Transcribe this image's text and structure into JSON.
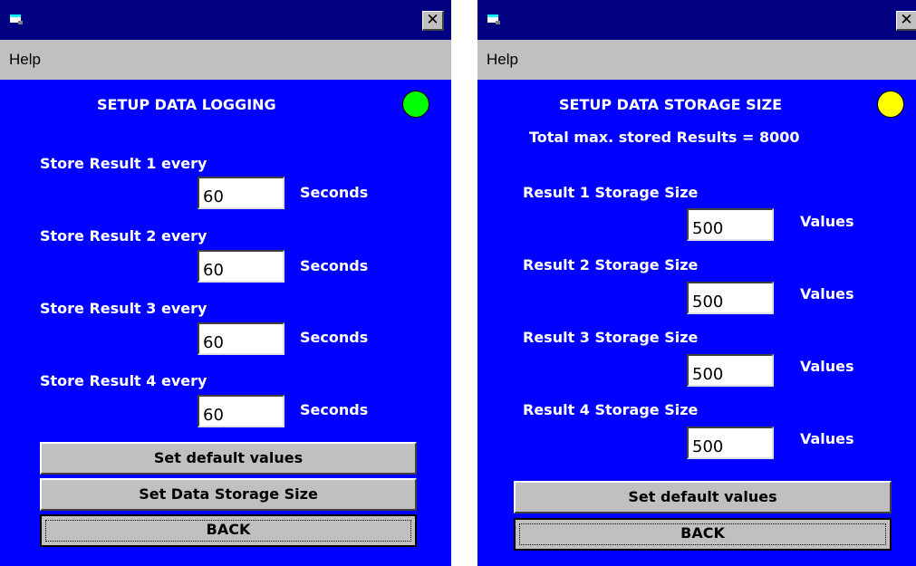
{
  "logging_window": {
    "menu": {
      "help_label": "Help"
    },
    "title": "SETUP DATA LOGGING",
    "status_color": "#00ff00",
    "rows": [
      {
        "label": "Store Result 1 every",
        "value": "60",
        "unit": "Seconds"
      },
      {
        "label": "Store Result 2 every",
        "value": "60",
        "unit": "Seconds"
      },
      {
        "label": "Store Result 3 every",
        "value": "60",
        "unit": "Seconds"
      },
      {
        "label": "Store Result 4 every",
        "value": "60",
        "unit": "Seconds"
      }
    ],
    "buttons": {
      "defaults_label": "Set default values",
      "storage_size_label": "Set Data Storage Size",
      "back_label": "BACK"
    }
  },
  "storage_window": {
    "menu": {
      "help_label": "Help"
    },
    "title": "SETUP DATA STORAGE SIZE",
    "subtitle": "Total max. stored Results = 8000",
    "status_color": "#ffff00",
    "rows": [
      {
        "label": "Result 1 Storage Size",
        "value": "500",
        "unit": "Values"
      },
      {
        "label": "Result 2 Storage Size",
        "value": "500",
        "unit": "Values"
      },
      {
        "label": "Result 3 Storage Size",
        "value": "500",
        "unit": "Values"
      },
      {
        "label": "Result 4 Storage Size",
        "value": "500",
        "unit": "Values"
      }
    ],
    "buttons": {
      "defaults_label": "Set default values",
      "back_label": "BACK"
    }
  },
  "colors": {
    "window_background": "#0000ff",
    "titlebar": "#000080",
    "menubar": "#c0c0c0"
  }
}
